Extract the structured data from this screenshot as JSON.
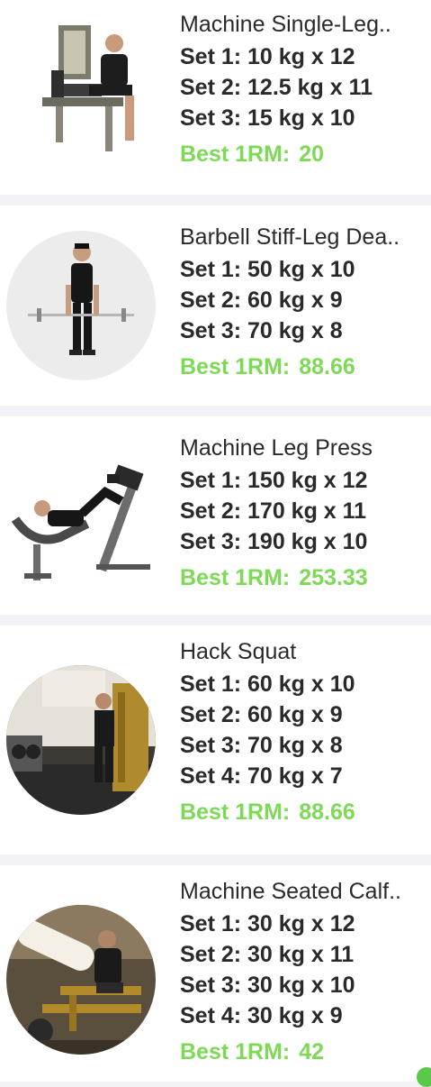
{
  "exercises": [
    {
      "title": "Machine Single-Leg..",
      "sets": [
        "Set 1: 10 kg x 12",
        "Set 2: 12.5 kg x 11",
        "Set 3: 15 kg x 10"
      ],
      "best_label": "Best 1RM:",
      "best_value": "20",
      "image": "leg-extension-machine-photo"
    },
    {
      "title": "Barbell Stiff-Leg Dea..",
      "sets": [
        "Set 1: 50 kg x 10",
        "Set 2: 60 kg x 9",
        "Set 3: 70 kg x 8"
      ],
      "best_label": "Best 1RM:",
      "best_value": "88.66",
      "image": "barbell-deadlift-photo"
    },
    {
      "title": "Machine Leg Press",
      "sets": [
        "Set 1: 150 kg x 12",
        "Set 2: 170 kg x 11",
        "Set 3: 190 kg x 10"
      ],
      "best_label": "Best 1RM:",
      "best_value": "253.33",
      "image": "leg-press-machine-photo"
    },
    {
      "title": "Hack Squat",
      "sets": [
        "Set 1: 60 kg x 10",
        "Set 2: 60 kg x 9",
        "Set 3: 70 kg x 8",
        "Set 4: 70 kg x 7"
      ],
      "best_label": "Best 1RM:",
      "best_value": "88.66",
      "image": "hack-squat-gym-photo"
    },
    {
      "title": "Machine Seated Calf..",
      "sets": [
        "Set 1: 30 kg x 12",
        "Set 2: 30 kg x 11",
        "Set 3: 30 kg x 10",
        "Set 4: 30 kg x 9"
      ],
      "best_label": "Best 1RM:",
      "best_value": "42",
      "image": "seated-calf-machine-photo"
    }
  ],
  "colors": {
    "best": "#7ed957",
    "text": "#2a2a2a",
    "separator": "#f3f3f7",
    "fab": "#5cc84a"
  }
}
